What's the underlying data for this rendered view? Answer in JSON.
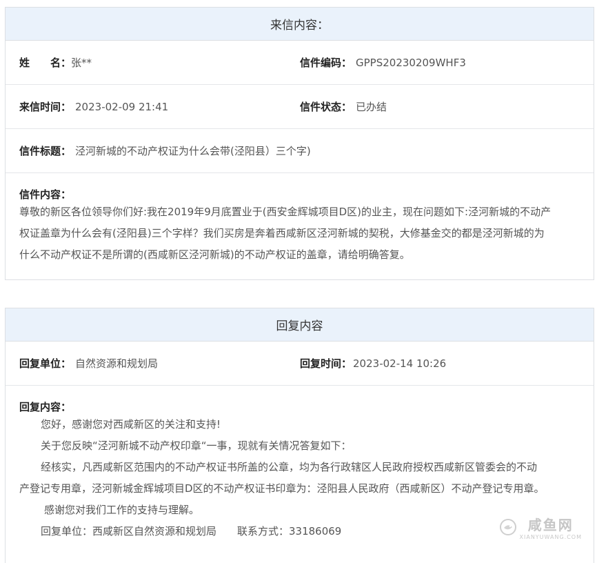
{
  "letter": {
    "header": "来信内容：",
    "name_label": "姓　　名：",
    "name_value": "张**",
    "code_label": "信件编码：",
    "code_value": "GPPS20230209WHF3",
    "time_label": "来信时间：",
    "time_value": "2023-02-09 21:41",
    "status_label": "信件状态：",
    "status_value": "已办结",
    "title_label": "信件标题：",
    "title_value": "泾河新城的不动产权证为什么会带(泾阳县）三个字)",
    "content_label": "信件内容：",
    "content_lines": [
      "尊敬的新区各位领导你们好:我在2019年9月底置业于(西安金辉城项目D区)的业主，现在问题如下:泾河新城的不动产",
      "权证盖章为什么会有(泾阳县)三个字样？我们买房是奔着西咸新区泾河新城的契税，大修基金交的都是泾河新城的为",
      "什么不动产权证不是所谓的(西咸新区泾河新城)的不动产权证的盖章，请给明确答复。"
    ]
  },
  "reply": {
    "header": "回复内容",
    "unit_label": "回复单位：",
    "unit_value": "自然资源和规划局",
    "time_label": "回复时间：",
    "time_value": "2023-02-14 10:26",
    "content_label": "回复内容：",
    "lines": [
      "您好，感谢您对西咸新区的关注和支持!",
      "关于您反映“泾河新城不动产权印章“一事，现就有关情况答复如下：",
      "经核实，凡西咸新区范围内的不动产权证书所盖的公章，均为各行政辖区人民政府授权西咸新区管委会的不动",
      "产登记专用章，泾河新城金辉城项目D区的不动产权证书印章为：泾阳县人民政府（西咸新区）不动产登记专用章。",
      "感谢您对我们工作的支持与理解。",
      "回复单位：西咸新区自然资源和规划局　　联系方式：33186069"
    ]
  },
  "watermark": {
    "cn": "咸鱼网",
    "en": "XIANYUWANG.COM",
    "icon": "fish-logo-icon"
  }
}
